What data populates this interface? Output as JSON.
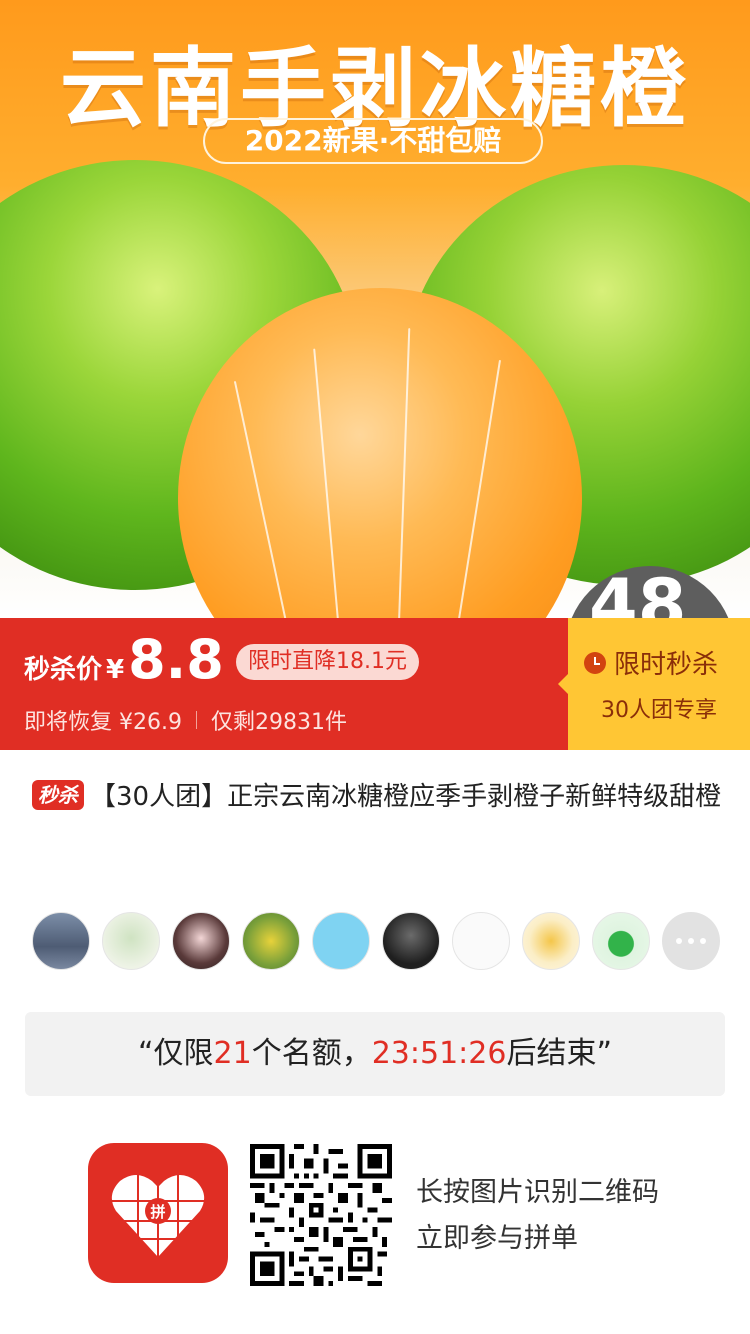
{
  "hero": {
    "title": "云南手剥冰糖橙",
    "subtitle": "2022新果·不甜包赔",
    "badge_partial": "48"
  },
  "price": {
    "label": "秒杀价",
    "currency": "¥",
    "value": "8.8",
    "discount_tag": "限时直降18.1元",
    "restore_text": "即将恢复 ¥26.9",
    "stock_text": "仅剩29831件"
  },
  "flash": {
    "title": "限时秒杀",
    "subtitle": "30人团专享"
  },
  "product": {
    "tag": "秒杀",
    "title": "【30人团】正宗云南冰糖橙应季手剥橙子新鲜特级甜橙"
  },
  "avatars": {
    "count_shown": 10
  },
  "quota": {
    "open_quote": "“",
    "prefix": "仅限",
    "count": "21",
    "mid": "个名额，",
    "countdown": "23:51:26",
    "suffix": "后结束",
    "close_quote": "”"
  },
  "bottom": {
    "logo_text": "拼",
    "hint_line1": "长按图片识别二维码",
    "hint_line2": "立即参与拼单"
  },
  "colors": {
    "brand_red": "#e02e24",
    "flash_yellow": "#ffc634",
    "flash_text": "#8a2e09"
  }
}
